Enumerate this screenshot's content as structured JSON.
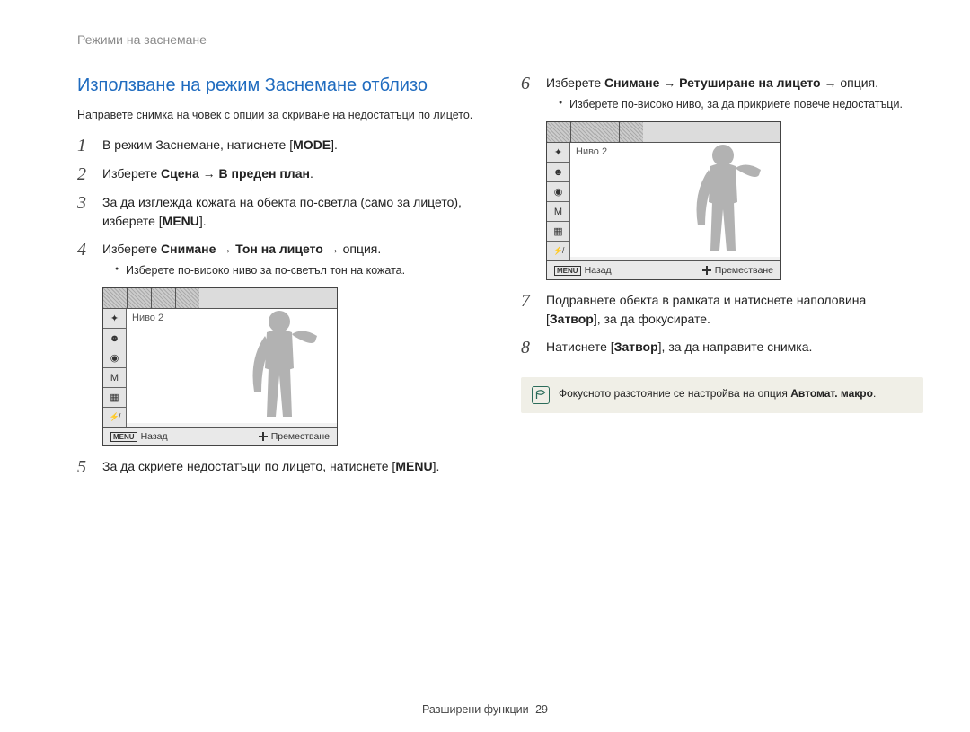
{
  "section_label": "Режими на заснемане",
  "title": "Използване на режим Заснемане отблизо",
  "subtitle": "Направете снимка на човек с опции за скриване на недостатъци по лицето.",
  "steps": {
    "s1_pre": "В режим Заснемане, натиснете [",
    "s1_btn": "MODE",
    "s1_post": "].",
    "s2_pre": "Изберете ",
    "s2_bold": "Сцена → В преден план",
    "s2_post": ".",
    "s3_pre": "За да изглежда кожата на обекта по-светла (само за лицето), изберете [",
    "s3_btn": "MENU",
    "s3_post": "].",
    "s4_pre": "Изберете ",
    "s4_bold": "Снимане → Тон на лицето →",
    "s4_post": " опция.",
    "s4_bullet": "Изберете по-високо ниво за по-светъл тон на кожата.",
    "s5_pre": "За да скриете недостатъци по лицето, натиснете [",
    "s5_btn": "MENU",
    "s5_post": "].",
    "s6_pre": "Изберете ",
    "s6_bold": "Снимане → Ретуширане на лицето →",
    "s6_post": " опция.",
    "s6_bullet": "Изберете по-високо ниво, за да прикриете повече недостатъци.",
    "s7_pre": "Подравнете обекта в рамката и натиснете наполовина [",
    "s7_btn": "Затвор",
    "s7_post": "], за да фокусирате.",
    "s8_pre": "Натиснете [",
    "s8_btn": "Затвор",
    "s8_post": "], за да направите снимка."
  },
  "lcd": {
    "level_label": "Ниво 2",
    "menu_label": "MENU",
    "back_label": "Назад",
    "move_label": "Преместване"
  },
  "note_pre": "Фокусното разстояние се настройва на опция ",
  "note_bold": "Автомат. макро",
  "note_post": ".",
  "footer_section": "Разширени функции",
  "footer_page": "29"
}
